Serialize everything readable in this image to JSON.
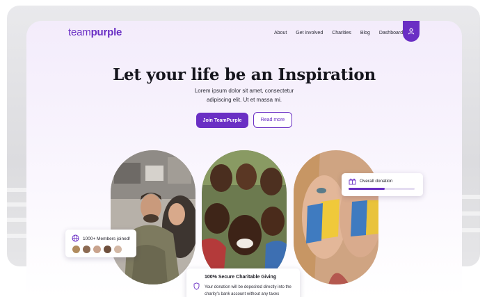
{
  "brand": {
    "name_light": "team",
    "name_bold": "purple",
    "accent_color": "#6a2fc4"
  },
  "nav": {
    "items": [
      "About",
      "Get involved",
      "Charities",
      "Blog",
      "Dashboard"
    ],
    "profile_icon": "user-icon"
  },
  "hero": {
    "title": "Let your life be an Inspiration",
    "subtitle_line1": "Lorem ipsum dolor sit amet, consectetur",
    "subtitle_line2": "adipiscing elit. Ut et massa mi.",
    "primary_button": "Join TeamPurple",
    "secondary_button": "Read more"
  },
  "members_card": {
    "icon": "globe-icon",
    "label": "1000+ Members joined!"
  },
  "donation_card": {
    "icon": "gift-icon",
    "label": "Overall donation",
    "progress": 0.55
  },
  "secure_card": {
    "icon": "shield-icon",
    "title": "100% Secure Charitable Giving",
    "body": "Your donation will be deposited directly into the charity's bank account without any taxes"
  },
  "images": [
    {
      "name": "soldier-family-photo"
    },
    {
      "name": "children-group-photo"
    },
    {
      "name": "painted-face-girls-photo"
    }
  ]
}
